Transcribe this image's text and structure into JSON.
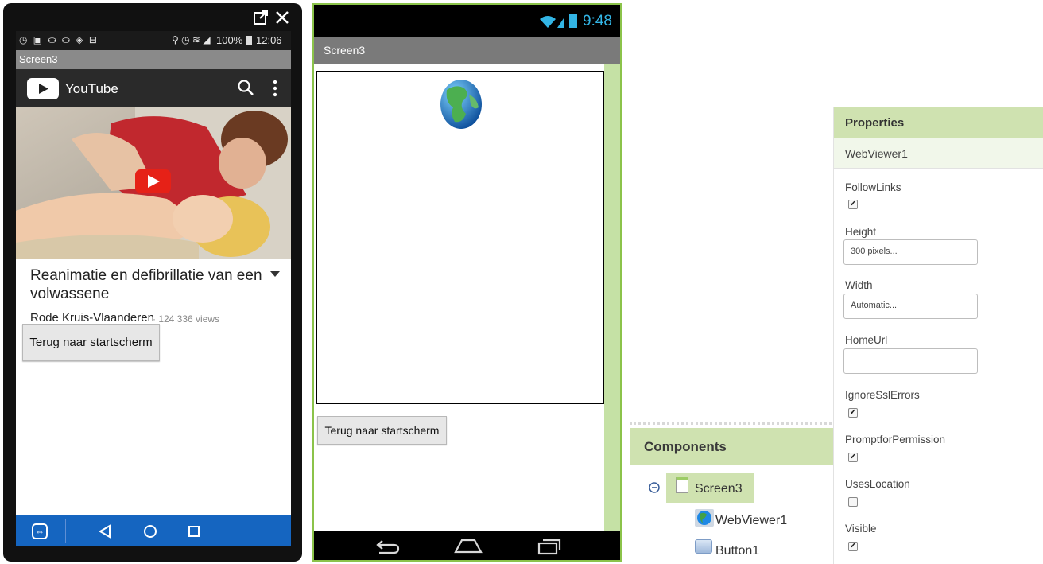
{
  "phone1": {
    "status_time": "12:06",
    "battery": "100%",
    "screen_title": "Screen3",
    "app_name": "YouTube",
    "video_title": "Reanimatie en defibrillatie van een volwassene",
    "channel": "Rode Kruis-Vlaanderen",
    "views": "· 124 336 views",
    "back_button": "Terug naar startscherm"
  },
  "phone2": {
    "status_time": "9:48",
    "screen_title": "Screen3",
    "back_button": "Terug naar startscherm"
  },
  "components": {
    "title": "Components",
    "tree": [
      "Screen3",
      "WebViewer1",
      "Button1"
    ]
  },
  "properties": {
    "title": "Properties",
    "component": "WebViewer1",
    "follow_links_label": "FollowLinks",
    "follow_links_checked": true,
    "height_label": "Height",
    "height_value": "300 pixels...",
    "width_label": "Width",
    "width_value": "Automatic...",
    "home_url_label": "HomeUrl",
    "home_url_value": "",
    "ignore_ssl_label": "IgnoreSslErrors",
    "ignore_ssl_checked": true,
    "prompt_label": "PromptforPermission",
    "prompt_checked": true,
    "uses_location_label": "UsesLocation",
    "uses_location_checked": false,
    "visible_label": "Visible",
    "visible_checked": true
  },
  "colors": {
    "panel_header": "#cfe2b0",
    "android_nav": "#1565c0",
    "emulator_border": "#8bc34a",
    "youtube_red": "#e62117"
  }
}
